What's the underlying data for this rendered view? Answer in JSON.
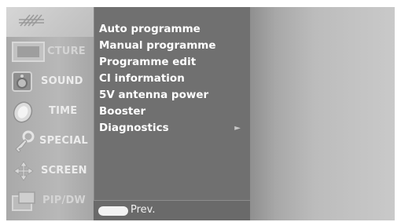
{
  "sidebar": {
    "items": [
      {
        "label": "CTURE",
        "icon": "picture-icon"
      },
      {
        "label": "SOUND",
        "icon": "sound-icon"
      },
      {
        "label": "TIME",
        "icon": "time-icon"
      },
      {
        "label": "SPECIAL",
        "icon": "special-icon"
      },
      {
        "label": "SCREEN",
        "icon": "screen-icon"
      },
      {
        "label": "PIP/DW",
        "icon": "pip-icon"
      }
    ]
  },
  "menu": {
    "items": [
      {
        "label": "Auto programme"
      },
      {
        "label": "Manual programme"
      },
      {
        "label": "Programme edit"
      },
      {
        "label": "CI information"
      },
      {
        "label": "5V antenna power"
      },
      {
        "label": "Booster"
      },
      {
        "label": "Diagnostics",
        "arrow": "►"
      }
    ],
    "footer": {
      "prev_label": "Prev."
    }
  },
  "colors": {
    "menu_bg": "#707070",
    "sidebar_bg": "#b3b3b3",
    "text": "#ffffff"
  }
}
